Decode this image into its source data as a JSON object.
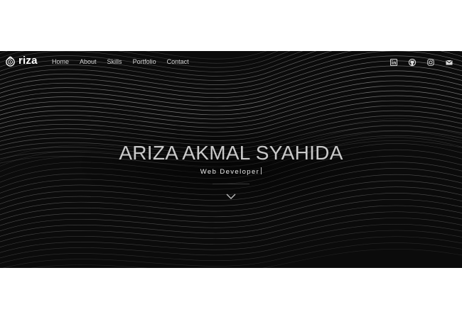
{
  "nav": {
    "brand": "riza",
    "items": [
      {
        "label": "Home"
      },
      {
        "label": "About"
      },
      {
        "label": "Skills"
      },
      {
        "label": "Portfolio"
      },
      {
        "label": "Contact"
      }
    ],
    "social_icons": [
      "linkedin-icon",
      "github-icon",
      "instagram-icon",
      "mail-icon"
    ]
  },
  "hero": {
    "name": "ARIZA AKMAL SYAHIDA",
    "role": "Web Developer"
  },
  "colors": {
    "background": "#0b0b0b",
    "text": "#c9c9c9",
    "page": "#ffffff"
  }
}
